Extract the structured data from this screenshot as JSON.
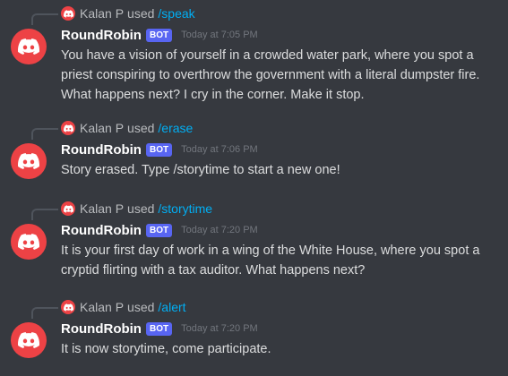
{
  "colors": {
    "background": "#36393f",
    "avatar": "#ed4245",
    "bot_badge": "#5865f2",
    "command_link": "#00aff4"
  },
  "icons": {
    "avatar": "discord-logo-icon",
    "mini_avatar": "discord-logo-icon"
  },
  "messages": [
    {
      "reply_user": "Kalan P",
      "reply_used": "used",
      "reply_command": "/speak",
      "author": "RoundRobin",
      "badge": "BOT",
      "timestamp": "Today at 7:05 PM",
      "text": "You have a vision of yourself in a crowded water park, where you spot a priest conspiring to overthrow the government with a literal dumpster fire. What happens next? I cry in the corner. Make it stop."
    },
    {
      "reply_user": "Kalan P",
      "reply_used": "used",
      "reply_command": "/erase",
      "author": "RoundRobin",
      "badge": "BOT",
      "timestamp": "Today at 7:06 PM",
      "text": "Story erased. Type /storytime to start a new one!"
    },
    {
      "reply_user": "Kalan P",
      "reply_used": "used",
      "reply_command": "/storytime",
      "author": "RoundRobin",
      "badge": "BOT",
      "timestamp": "Today at 7:20 PM",
      "text": "It is your first day of work in a wing of the White House, where you spot a cryptid flirting with a tax auditor. What happens next?"
    },
    {
      "reply_user": "Kalan P",
      "reply_used": "used",
      "reply_command": "/alert",
      "author": "RoundRobin",
      "badge": "BOT",
      "timestamp": "Today at 7:20 PM",
      "text": "It is now storytime, come participate."
    }
  ]
}
